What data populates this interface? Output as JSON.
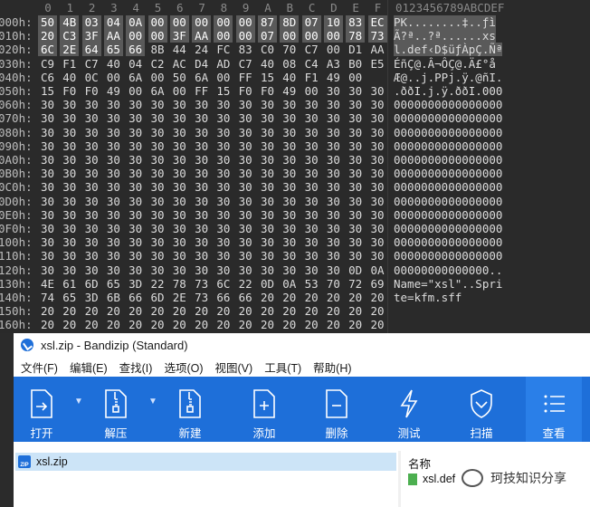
{
  "hex_editor": {
    "column_headers": [
      "0",
      "1",
      "2",
      "3",
      "4",
      "5",
      "6",
      "7",
      "8",
      "9",
      "A",
      "B",
      "C",
      "D",
      "E",
      "F"
    ],
    "ascii_header": "0123456789ABCDEF",
    "rows": [
      {
        "offset": "000h:",
        "bytes": [
          "50",
          "4B",
          "03",
          "04",
          "0A",
          "00",
          "00",
          "00",
          "00",
          "00",
          "87",
          "8D",
          "07",
          "10",
          "83",
          "EC"
        ],
        "ascii": "PK........‡..ƒì"
      },
      {
        "offset": "010h:",
        "bytes": [
          "20",
          "C3",
          "3F",
          "AA",
          "00",
          "00",
          "3F",
          "AA",
          "00",
          "00",
          "07",
          "00",
          "00",
          "00",
          "78",
          "73"
        ],
        "ascii": " Ã?ª..?ª......xs"
      },
      {
        "offset": "020h:",
        "bytes": [
          "6C",
          "2E",
          "64",
          "65",
          "66",
          "8B",
          "44",
          "24",
          "FC",
          "83",
          "C0",
          "70",
          "C7",
          "00",
          "D1",
          "AA"
        ],
        "ascii": "l.def‹D$üƒÀpÇ.Ñª"
      },
      {
        "offset": "030h:",
        "bytes": [
          "C9",
          "F1",
          "C7",
          "40",
          "04",
          "C2",
          "AC",
          "D4",
          "AD",
          "C7",
          "40",
          "08",
          "C4",
          "A3",
          "B0",
          "E5"
        ],
        "ascii": "ÉñÇ@.Â¬Ô­Ç@.Ä£°å"
      },
      {
        "offset": "040h:",
        "bytes": [
          "C6",
          "40",
          "0C",
          "00",
          "6A",
          "00",
          "50",
          "6A",
          "00",
          "FF",
          "15",
          "40",
          "F1",
          "49",
          "00"
        ],
        "ascii": "Æ@..j.PPj.ÿ.@ñI."
      },
      {
        "offset": "050h:",
        "bytes": [
          "15",
          "F0",
          "F0",
          "49",
          "00",
          "6A",
          "00",
          "FF",
          "15",
          "F0",
          "F0",
          "49",
          "00",
          "30",
          "30",
          "30"
        ],
        "ascii": ".ððI.j.ÿ.ððI.000"
      },
      {
        "offset": "060h:",
        "bytes": [
          "30",
          "30",
          "30",
          "30",
          "30",
          "30",
          "30",
          "30",
          "30",
          "30",
          "30",
          "30",
          "30",
          "30",
          "30",
          "30"
        ],
        "ascii": "0000000000000000"
      },
      {
        "offset": "070h:",
        "bytes": [
          "30",
          "30",
          "30",
          "30",
          "30",
          "30",
          "30",
          "30",
          "30",
          "30",
          "30",
          "30",
          "30",
          "30",
          "30",
          "30"
        ],
        "ascii": "0000000000000000"
      },
      {
        "offset": "080h:",
        "bytes": [
          "30",
          "30",
          "30",
          "30",
          "30",
          "30",
          "30",
          "30",
          "30",
          "30",
          "30",
          "30",
          "30",
          "30",
          "30",
          "30"
        ],
        "ascii": "0000000000000000"
      },
      {
        "offset": "090h:",
        "bytes": [
          "30",
          "30",
          "30",
          "30",
          "30",
          "30",
          "30",
          "30",
          "30",
          "30",
          "30",
          "30",
          "30",
          "30",
          "30",
          "30"
        ],
        "ascii": "0000000000000000"
      },
      {
        "offset": "0A0h:",
        "bytes": [
          "30",
          "30",
          "30",
          "30",
          "30",
          "30",
          "30",
          "30",
          "30",
          "30",
          "30",
          "30",
          "30",
          "30",
          "30",
          "30"
        ],
        "ascii": "0000000000000000"
      },
      {
        "offset": "0B0h:",
        "bytes": [
          "30",
          "30",
          "30",
          "30",
          "30",
          "30",
          "30",
          "30",
          "30",
          "30",
          "30",
          "30",
          "30",
          "30",
          "30",
          "30"
        ],
        "ascii": "0000000000000000"
      },
      {
        "offset": "0C0h:",
        "bytes": [
          "30",
          "30",
          "30",
          "30",
          "30",
          "30",
          "30",
          "30",
          "30",
          "30",
          "30",
          "30",
          "30",
          "30",
          "30",
          "30"
        ],
        "ascii": "0000000000000000"
      },
      {
        "offset": "0D0h:",
        "bytes": [
          "30",
          "30",
          "30",
          "30",
          "30",
          "30",
          "30",
          "30",
          "30",
          "30",
          "30",
          "30",
          "30",
          "30",
          "30",
          "30"
        ],
        "ascii": "0000000000000000"
      },
      {
        "offset": "0E0h:",
        "bytes": [
          "30",
          "30",
          "30",
          "30",
          "30",
          "30",
          "30",
          "30",
          "30",
          "30",
          "30",
          "30",
          "30",
          "30",
          "30",
          "30"
        ],
        "ascii": "0000000000000000"
      },
      {
        "offset": "0F0h:",
        "bytes": [
          "30",
          "30",
          "30",
          "30",
          "30",
          "30",
          "30",
          "30",
          "30",
          "30",
          "30",
          "30",
          "30",
          "30",
          "30",
          "30"
        ],
        "ascii": "0000000000000000"
      },
      {
        "offset": "100h:",
        "bytes": [
          "30",
          "30",
          "30",
          "30",
          "30",
          "30",
          "30",
          "30",
          "30",
          "30",
          "30",
          "30",
          "30",
          "30",
          "30",
          "30"
        ],
        "ascii": "0000000000000000"
      },
      {
        "offset": "110h:",
        "bytes": [
          "30",
          "30",
          "30",
          "30",
          "30",
          "30",
          "30",
          "30",
          "30",
          "30",
          "30",
          "30",
          "30",
          "30",
          "30",
          "30"
        ],
        "ascii": "0000000000000000"
      },
      {
        "offset": "120h:",
        "bytes": [
          "30",
          "30",
          "30",
          "30",
          "30",
          "30",
          "30",
          "30",
          "30",
          "30",
          "30",
          "30",
          "30",
          "30",
          "0D",
          "0A"
        ],
        "ascii": "00000000000000.."
      },
      {
        "offset": "130h:",
        "bytes": [
          "4E",
          "61",
          "6D",
          "65",
          "3D",
          "22",
          "78",
          "73",
          "6C",
          "22",
          "0D",
          "0A",
          "53",
          "70",
          "72",
          "69"
        ],
        "ascii": "Name=\"xsl\"..Spri"
      },
      {
        "offset": "140h:",
        "bytes": [
          "74",
          "65",
          "3D",
          "6B",
          "66",
          "6D",
          "2E",
          "73",
          "66",
          "66",
          "20",
          "20",
          "20",
          "20",
          "20",
          "20"
        ],
        "ascii": "te=kfm.sff"
      },
      {
        "offset": "150h:",
        "bytes": [
          "20",
          "20",
          "20",
          "20",
          "20",
          "20",
          "20",
          "20",
          "20",
          "20",
          "20",
          "20",
          "20",
          "20",
          "20",
          "20"
        ],
        "ascii": ""
      },
      {
        "offset": "160h:",
        "bytes": [
          "20",
          "20",
          "20",
          "20",
          "20",
          "20",
          "20",
          "20",
          "20",
          "20",
          "20",
          "20",
          "20",
          "20",
          "20",
          "20"
        ],
        "ascii": ""
      }
    ]
  },
  "bandizip": {
    "title": "xsl.zip - Bandizip (Standard)",
    "menu": [
      "文件(F)",
      "编辑(E)",
      "查找(I)",
      "选项(O)",
      "视图(V)",
      "工具(T)",
      "帮助(H)"
    ],
    "toolbar": {
      "open": "打开",
      "extract": "解压",
      "new": "新建",
      "add": "添加",
      "delete": "删除",
      "test": "测试",
      "scan": "扫描",
      "view": "查看"
    },
    "tree_item": "xsl.zip",
    "list_header": "名称",
    "list_item": "xsl.def"
  },
  "watermark": "珂技知识分享"
}
